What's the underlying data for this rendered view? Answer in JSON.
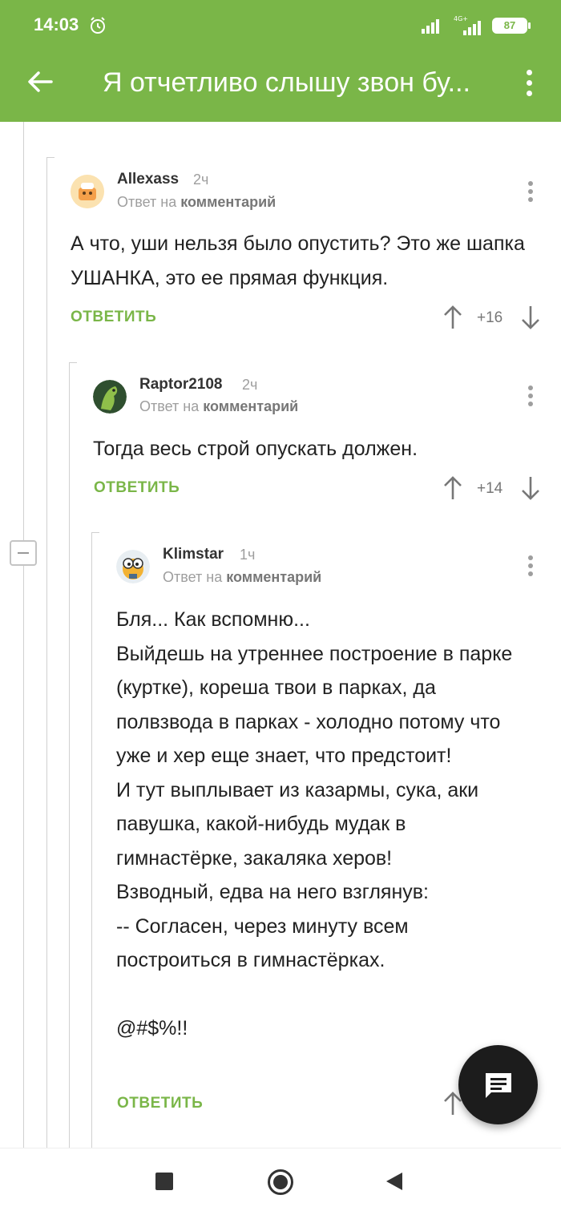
{
  "status_bar": {
    "time": "14:03",
    "network": "4G+",
    "battery": "87"
  },
  "toolbar": {
    "title": "Я отчетливо слышу звон бу..."
  },
  "comments": [
    {
      "author": "Allexass",
      "age": "2ч",
      "reply_prefix": "Ответ на",
      "reply_target": "комментарий",
      "text": "А что, уши нельзя было опустить? Это же шапка УШАНКА, это ее прямая функция.",
      "reply_label": "ОТВЕТИТЬ",
      "score": "+16"
    },
    {
      "author": "Raptor2108",
      "age": "2ч",
      "reply_prefix": "Ответ на",
      "reply_target": "комментарий",
      "text": "Тогда весь строй опускать должен.",
      "reply_label": "ОТВЕТИТЬ",
      "score": "+14"
    },
    {
      "author": "Klimstar",
      "age": "1ч",
      "reply_prefix": "Ответ на",
      "reply_target": "комментарий",
      "text": "Бля... Как вспомню...\nВыйдешь на утреннее построение в парке (куртке), кореша твои в парках, да полвзвода в парках - холодно потому что уже и хер еще знает, что предстоит!\nИ тут выплывает из казармы, сука, аки павушка, какой-нибудь мудак в гимнастёрке, закаляка херов!\nВзводный, едва на него взглянув:\n-- Согласен, через минуту всем построиться в гимнастёрках.\n\n@#$%!!",
      "reply_label": "ОТВЕТИТЬ"
    }
  ],
  "colors": {
    "accent": "#7ab648",
    "fab": "#1c1c1c"
  },
  "icons": [
    "back-arrow-icon",
    "more-vert-icon",
    "alarm-icon",
    "arrow-up-icon",
    "arrow-down-icon",
    "chat-icon",
    "collapse-icon"
  ]
}
